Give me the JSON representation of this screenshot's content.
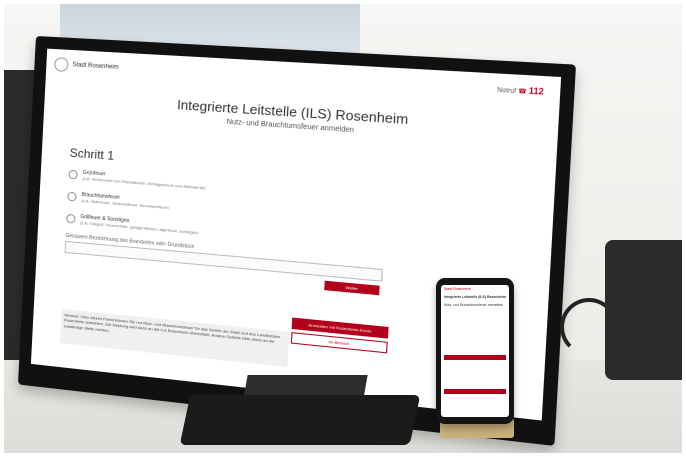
{
  "screen": {
    "logo_text": "Stadt Rosenheim",
    "notruf_label": "Notruf",
    "notruf_number": "112",
    "title": "Integrierte Leitstelle (ILS) Rosenheim",
    "subtitle": "Nutz- und Brauchtumsfeuer anmelden",
    "step": "Schritt 1",
    "options": [
      {
        "title": "Grünfeuer",
        "desc": "(z.B. Verbrennen von Rückständen, Schlagabraum und Astmaterial)"
      },
      {
        "title": "Brauchtumsfeuer",
        "desc": "(z.B. Osterfeuer, Johannisfeuer, Sonnwendfeuer)"
      },
      {
        "title": "Grillfeuer & Sonstiges",
        "desc": "(z.B. Gasgrill, Feuerschale, gelegentliches Lagerfeuer, sonstiges)"
      }
    ],
    "field_label": "Genauere Bezeichnung des Brandortes oder Grundstück",
    "continue_button": "Weiter",
    "login_button": "Anmelden mit Rosenheim-Konto",
    "other_button": "Im Bereich",
    "notice": "Hinweis: Über dieses Portal können Sie nur Nutz- und Brauchtumsfeuer für das Gebiet der Stadt und des Landkreises Rosenheim anmelden. Die Meldung wird dann an die ILS Rosenheim übermittelt. Andere Gebiete bitte direkt an die zuständige Stelle melden."
  },
  "phone": {
    "logo_text": "Stadt Rosenheim",
    "title": "Integrierte Leitstelle (ILS) Rosenheim",
    "subtitle": "Nutz- und Brauchtumsfeuer anmelden"
  }
}
